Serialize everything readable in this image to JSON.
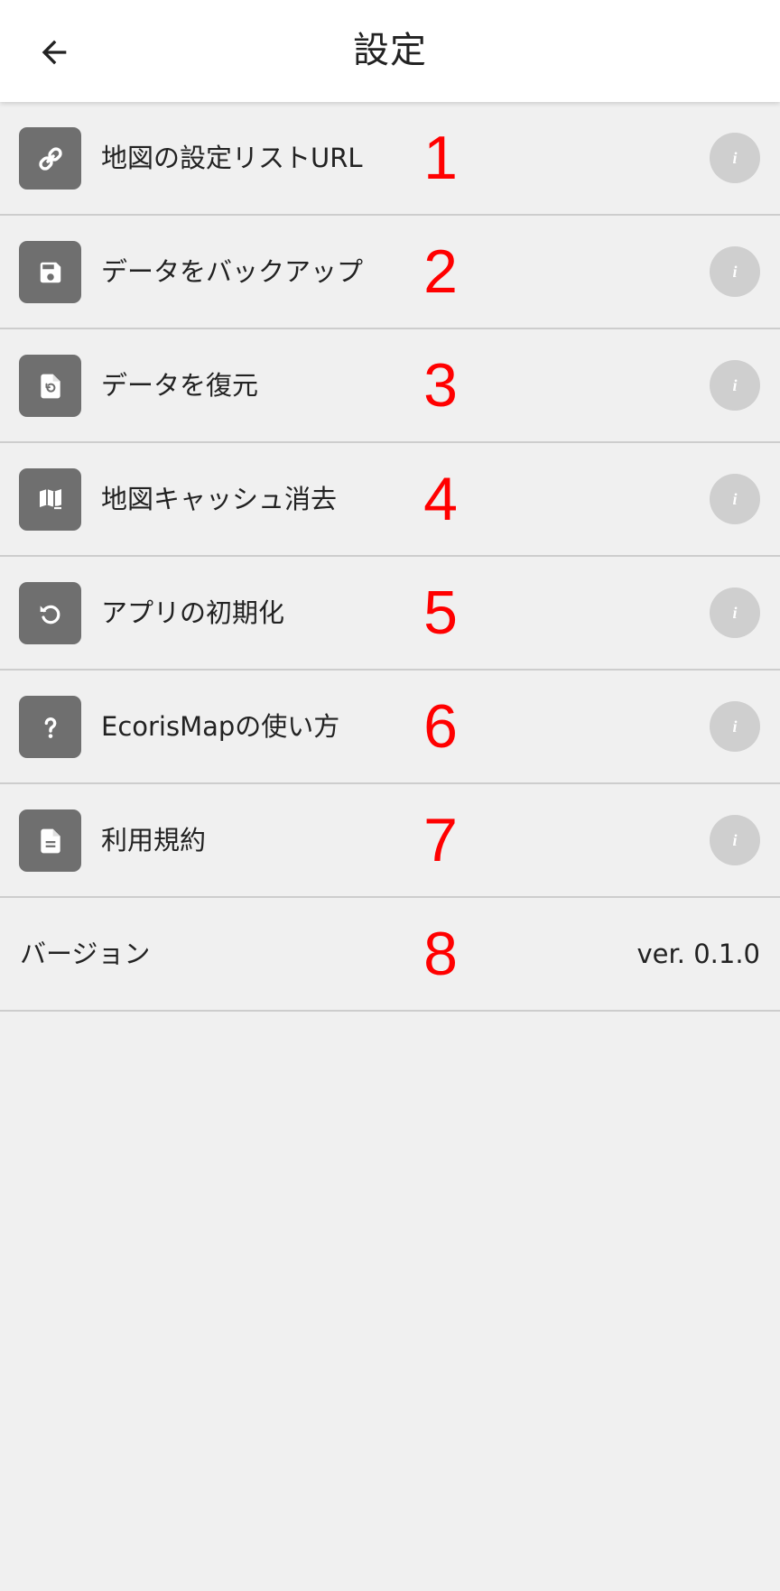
{
  "header": {
    "title": "設定",
    "back_icon": "arrow-left-icon"
  },
  "items": [
    {
      "label": "地図の設定リストURL",
      "number": "1",
      "icon": "link-icon",
      "info_icon": "info-icon",
      "info_glyph": "i"
    },
    {
      "label": "データをバックアップ",
      "number": "2",
      "icon": "save-icon",
      "info_icon": "info-icon",
      "info_glyph": "i"
    },
    {
      "label": "データを復元",
      "number": "3",
      "icon": "restore-file-icon",
      "info_icon": "info-icon",
      "info_glyph": "i"
    },
    {
      "label": "地図キャッシュ消去",
      "number": "4",
      "icon": "map-icon",
      "info_icon": "info-icon",
      "info_glyph": "i"
    },
    {
      "label": "アプリの初期化",
      "number": "5",
      "icon": "reset-icon",
      "info_icon": "info-icon",
      "info_glyph": "i"
    },
    {
      "label": "EcorisMapの使い方",
      "number": "6",
      "icon": "question-icon",
      "info_icon": "info-icon",
      "info_glyph": "i"
    },
    {
      "label": "利用規約",
      "number": "7",
      "icon": "document-icon",
      "info_icon": "info-icon",
      "info_glyph": "i"
    }
  ],
  "version": {
    "label": "バージョン",
    "number": "8",
    "value": "ver. 0.1.0"
  },
  "colors": {
    "header_bg": "#ffffff",
    "page_bg": "#f0f0f0",
    "icon_tile": "#6f6f6f",
    "info_circle": "#cfcfcf",
    "annotation_red": "#ff0000",
    "divider": "#cdcdcd"
  }
}
